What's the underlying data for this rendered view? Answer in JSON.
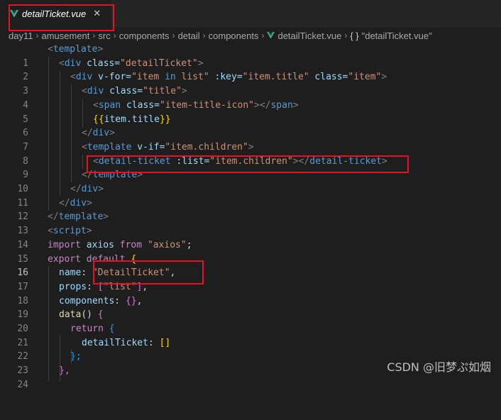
{
  "tab": {
    "label": "detailTicket.vue",
    "close_glyph": "✕",
    "icon": "vue-icon"
  },
  "breadcrumb": {
    "items": [
      "day11",
      "amusement",
      "src",
      "components",
      "detail",
      "components",
      "detailTicket.vue"
    ],
    "symbol_brace": "{ }",
    "symbol_label": "\"detailTicket.vue\"",
    "separator": "›"
  },
  "line_numbers": [
    "1",
    "2",
    "3",
    "4",
    "5",
    "6",
    "7",
    "8",
    "9",
    "10",
    "11",
    "12",
    "13",
    "14",
    "15",
    "16",
    "17",
    "18",
    "19",
    "20",
    "21",
    "22",
    "23",
    "24"
  ],
  "active_line": 16,
  "code": {
    "l1": [
      "<",
      "template",
      ">"
    ],
    "l2": [
      "<",
      "div",
      " class=",
      "\"detailTicket\"",
      ">"
    ],
    "l3": [
      "<",
      "div",
      " v-for=",
      "\"item ",
      "in",
      " list\"",
      " :key=",
      "\"item.title\"",
      " class=",
      "\"item\"",
      ">"
    ],
    "l4": [
      "<",
      "div",
      " class=",
      "\"title\"",
      ">"
    ],
    "l5": [
      "<",
      "span",
      " class=",
      "\"item-title-icon\"",
      "></",
      "span",
      ">"
    ],
    "l6": [
      "{{",
      "item.title",
      "}}"
    ],
    "l7": [
      "</",
      "div",
      ">"
    ],
    "l8": [
      "<",
      "template",
      " v-if=",
      "\"item.children\"",
      ">"
    ],
    "l9": [
      "<",
      "detail-ticket",
      " :list=",
      "\"item.children\"",
      "></",
      "detail-ticket",
      ">"
    ],
    "l10": [
      "</",
      "template",
      ">"
    ],
    "l11": [
      "</",
      "div",
      ">"
    ],
    "l12": [
      "</",
      "div",
      ">"
    ],
    "l13": [
      "</",
      "template",
      ">"
    ],
    "l14": [
      "<",
      "script",
      ">"
    ],
    "l15": [
      "import",
      " axios ",
      "from",
      " \"axios\"",
      ";"
    ],
    "l16": [
      "export",
      " ",
      "default",
      " {"
    ],
    "l17": [
      "name",
      ": ",
      "\"DetailTicket\"",
      ","
    ],
    "l18": [
      "props",
      ": ",
      "[",
      "\"list\"",
      "]",
      ","
    ],
    "l19": [
      "components",
      ": ",
      "{}",
      ","
    ],
    "l20": [
      "data",
      "() ",
      "{"
    ],
    "l21": [
      "return",
      " ",
      "{"
    ],
    "l22": [
      "detailTicket",
      ": ",
      "[]"
    ],
    "l23": [
      "};"
    ],
    "l24": [
      "},"
    ]
  },
  "watermark": "CSDN @旧梦ぷ如烟",
  "colors": {
    "background": "#1e1e1e",
    "tag": "#569cd6",
    "attribute": "#9cdcfe",
    "string": "#ce9178",
    "keyword": "#c586c0",
    "highlight_box": "#e81123"
  }
}
